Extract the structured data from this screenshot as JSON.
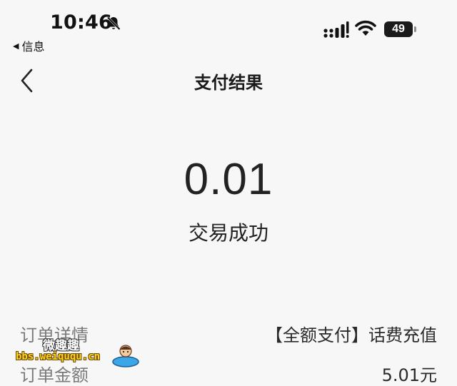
{
  "status_bar": {
    "time": "10:46",
    "back_app_label": "信息",
    "battery_level": "49",
    "icons": [
      "bell-slash-icon",
      "signal-icon",
      "wifi-icon",
      "battery-icon"
    ]
  },
  "nav": {
    "title": "支付结果",
    "back_icon": "chevron-left-icon"
  },
  "result": {
    "amount": "0.01",
    "status": "交易成功"
  },
  "details": [
    {
      "label": "订单详情",
      "value": "【全额支付】话费充值"
    },
    {
      "label": "订单金额",
      "value": "5.01元"
    }
  ],
  "watermark": {
    "site_name": "微趣趣",
    "url": "bbs.weiququ.cn"
  },
  "colors": {
    "background": "#f7f7f7",
    "text_primary": "#1f1f1f",
    "text_secondary": "#7a7a7a"
  }
}
